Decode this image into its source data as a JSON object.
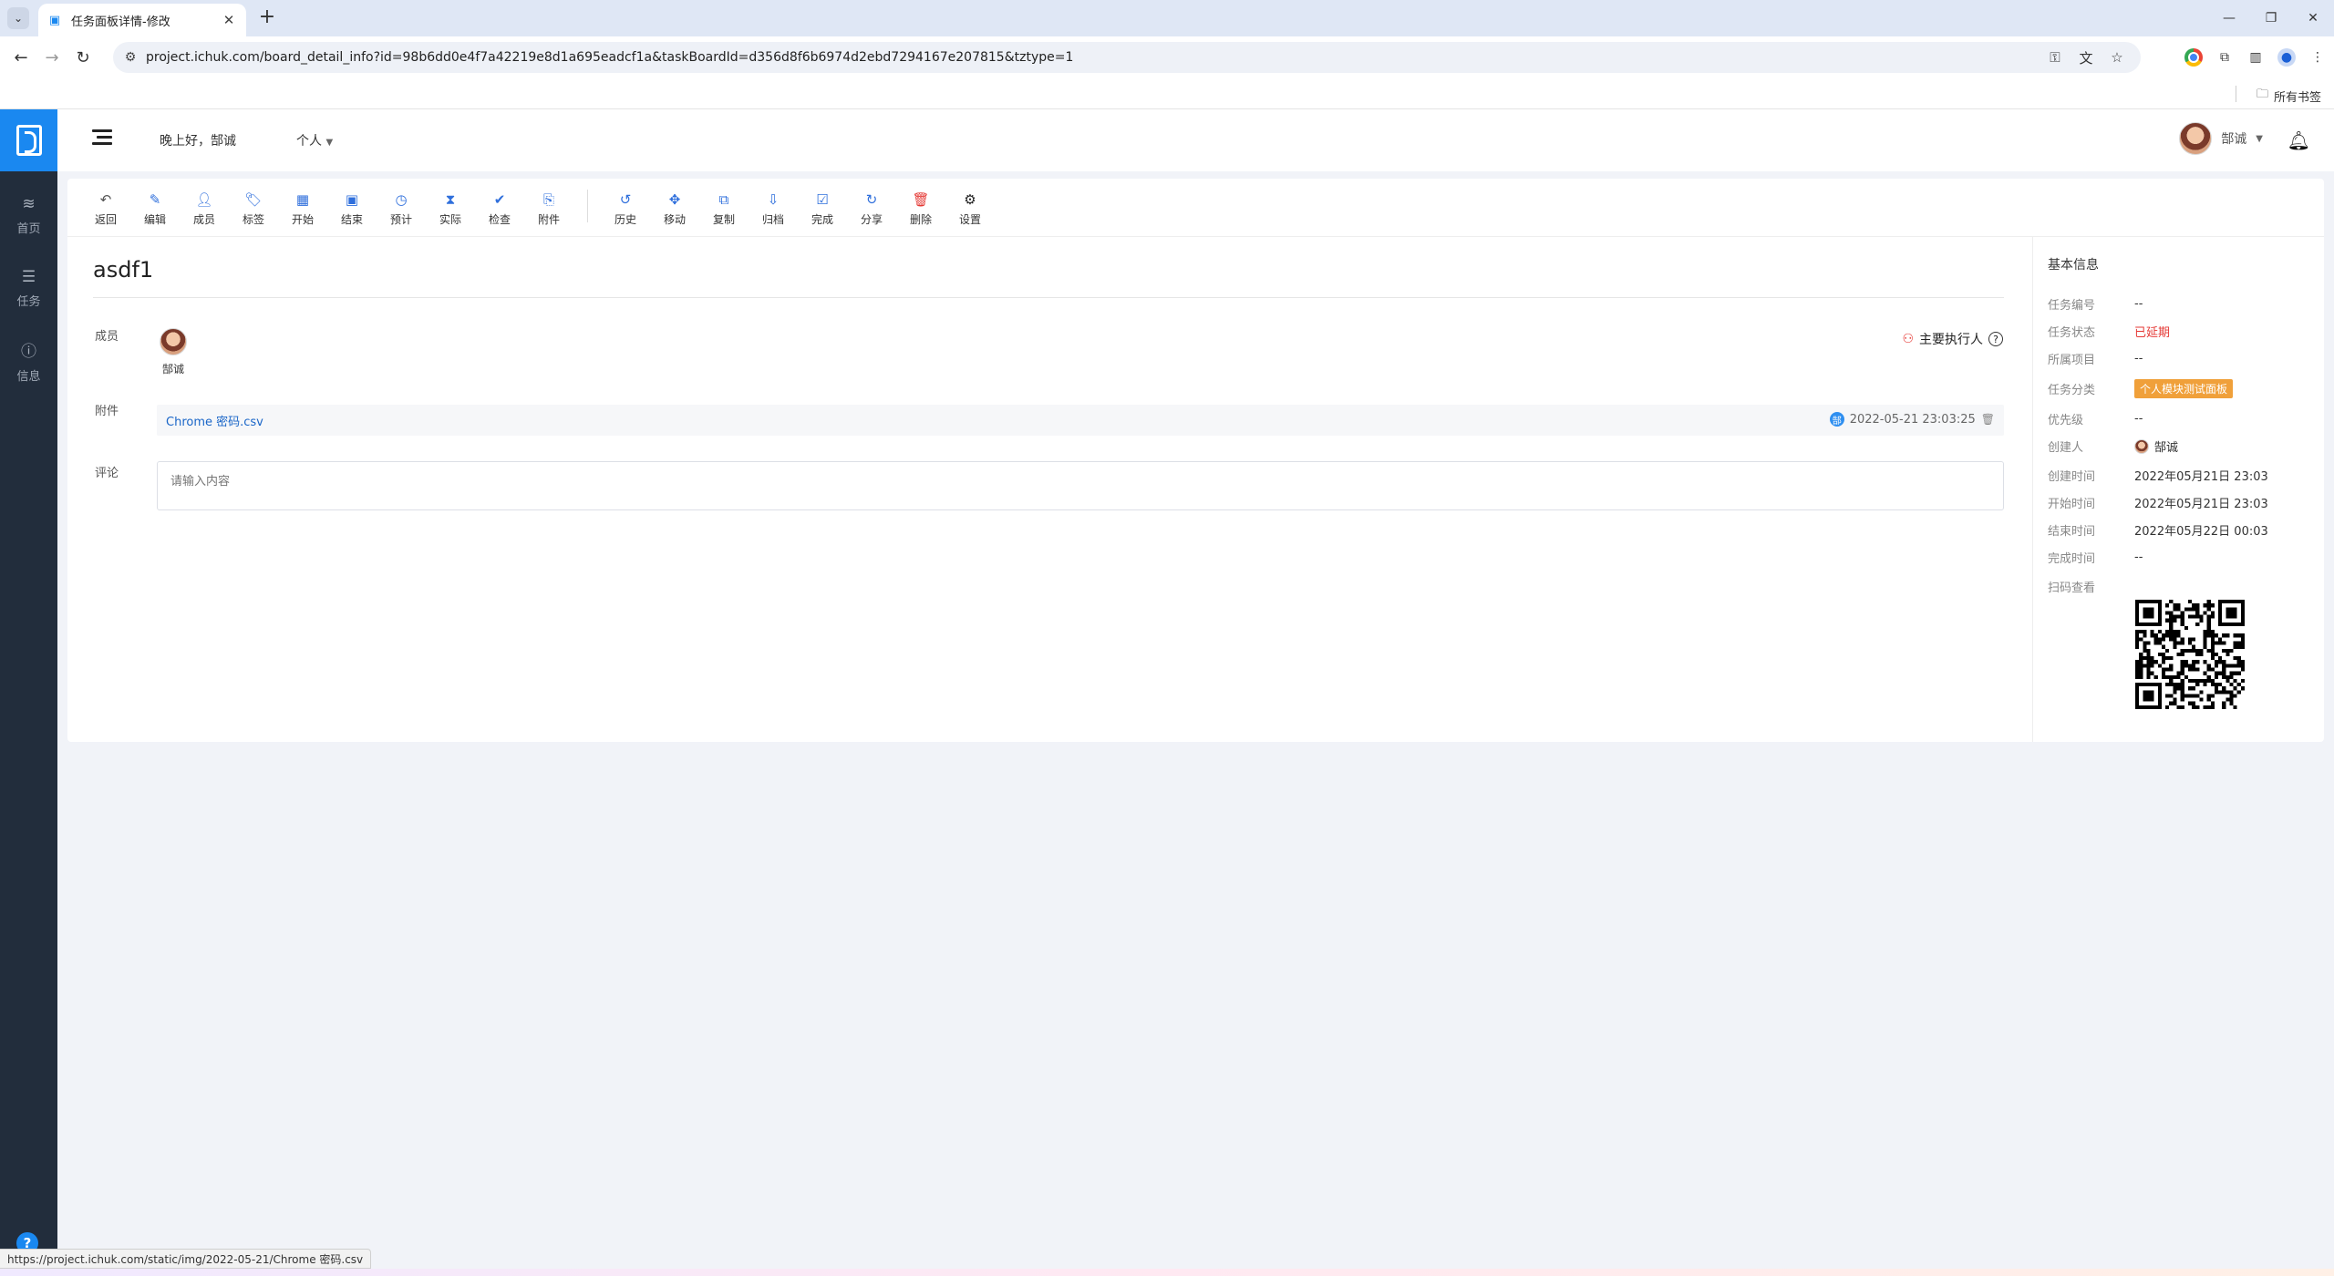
{
  "browser": {
    "tab_title": "任务面板详情-修改",
    "url": "project.ichuk.com/board_detail_info?id=98b6dd0e4f7a42219e8d1a695eadcf1a&taskBoardId=d356d8f6b6974d2ebd7294167e207815&tztype=1",
    "bookmarks_label": "所有书签",
    "status_url": "https://project.ichuk.com/static/img/2022-05-21/Chrome 密码.csv"
  },
  "sidebar": {
    "items": [
      {
        "label": "首页",
        "icon": "layers-icon"
      },
      {
        "label": "任务",
        "icon": "list-icon"
      },
      {
        "label": "信息",
        "icon": "info-icon"
      }
    ]
  },
  "header": {
    "greeting": "晚上好，郜诚",
    "scope": "个人",
    "user_name": "郜诚"
  },
  "actions": [
    {
      "label": "返回",
      "icon": "undo-icon"
    },
    {
      "label": "编辑",
      "icon": "edit-icon"
    },
    {
      "label": "成员",
      "icon": "user-icon"
    },
    {
      "label": "标签",
      "icon": "tag-icon"
    },
    {
      "label": "开始",
      "icon": "calendar-start-icon"
    },
    {
      "label": "结束",
      "icon": "calendar-end-icon"
    },
    {
      "label": "预计",
      "icon": "clock-icon"
    },
    {
      "label": "实际",
      "icon": "hourglass-icon"
    },
    {
      "label": "检查",
      "icon": "check-circle-icon"
    },
    {
      "label": "附件",
      "icon": "paperclip-icon"
    },
    {
      "label": "历史",
      "icon": "history-icon"
    },
    {
      "label": "移动",
      "icon": "move-icon"
    },
    {
      "label": "复制",
      "icon": "copy-icon"
    },
    {
      "label": "归档",
      "icon": "archive-icon"
    },
    {
      "label": "完成",
      "icon": "complete-icon"
    },
    {
      "label": "分享",
      "icon": "share-icon"
    },
    {
      "label": "删除",
      "icon": "trash-icon"
    },
    {
      "label": "设置",
      "icon": "gear-icon"
    }
  ],
  "task": {
    "title": "asdf1",
    "members_label": "成员",
    "member_name": "郜诚",
    "main_executor_label": "主要执行人",
    "attachments_label": "附件",
    "attachment_name": "Chrome 密码.csv",
    "attachment_time": "2022-05-21 23:03:25",
    "comments_label": "评论",
    "comment_placeholder": "请输入内容"
  },
  "info": {
    "title": "基本信息",
    "rows": [
      {
        "key": "任务编号",
        "value": "--"
      },
      {
        "key": "任务状态",
        "value": "已延期"
      },
      {
        "key": "所属项目",
        "value": "--"
      },
      {
        "key": "任务分类",
        "value": "个人模块测试面板"
      },
      {
        "key": "优先级",
        "value": "--"
      },
      {
        "key": "创建人",
        "value": "郜诚"
      },
      {
        "key": "创建时间",
        "value": "2022年05月21日 23:03"
      },
      {
        "key": "开始时间",
        "value": "2022年05月21日 23:03"
      },
      {
        "key": "结束时间",
        "value": "2022年05月22日 00:03"
      },
      {
        "key": "完成时间",
        "value": "--"
      },
      {
        "key": "扫码查看",
        "value": ""
      }
    ]
  },
  "colors": {
    "brand": "#1a88f0",
    "sidebar": "#222d3c",
    "overdue": "#e53935",
    "category_tag": "#f0a03a"
  }
}
